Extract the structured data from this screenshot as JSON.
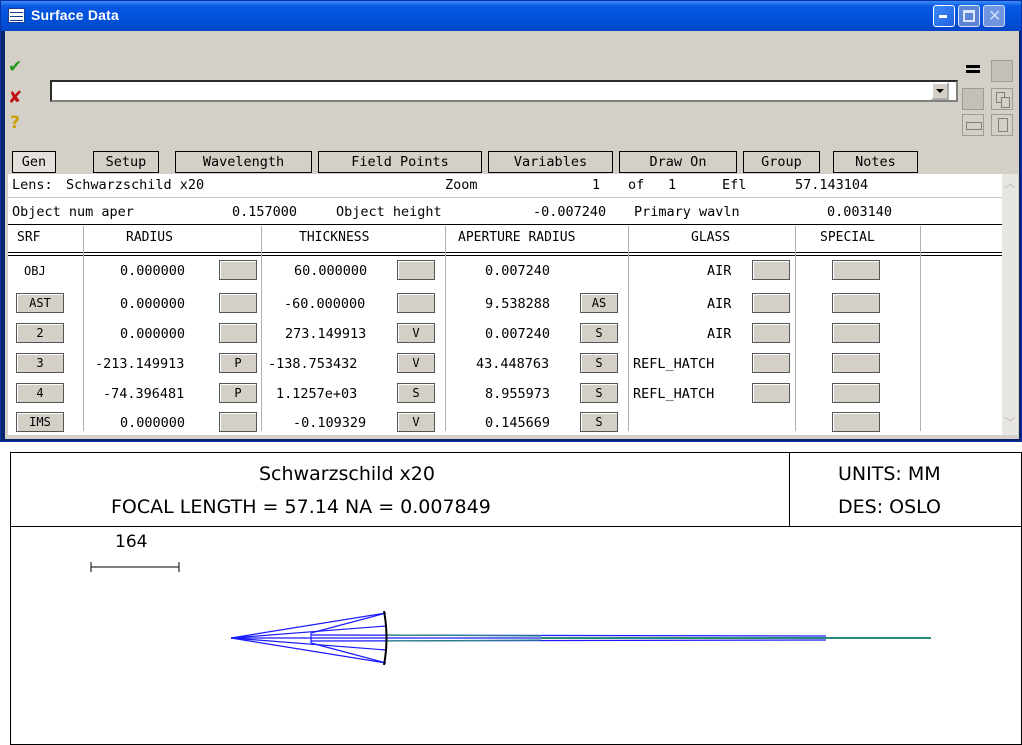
{
  "window": {
    "title": "Surface Data"
  },
  "command": {
    "accept_icon": "✔",
    "cancel_icon": "✘",
    "help_icon": "?",
    "input_value": ""
  },
  "tabs": [
    "Gen",
    "Setup",
    "Wavelength",
    "Field Points",
    "Variables",
    "Draw On",
    "Group",
    "Notes"
  ],
  "info": {
    "lens_label": "Lens:",
    "lens_name": "Schwarzschild x20",
    "zoom_label": "Zoom",
    "zoom_value": "1",
    "zoom_of": "of",
    "zoom_total": "1",
    "efl_label": "Efl",
    "efl_value": "57.143104",
    "obj_na_label": "Object num aper",
    "obj_na_value": "0.157000",
    "obj_height_label": "Object height",
    "obj_height_value": "-0.007240",
    "prim_wavln_label": "Primary wavln",
    "prim_wavln_value": "0.003140"
  },
  "columns": [
    "SRF",
    "RADIUS",
    "THICKNESS",
    "APERTURE RADIUS",
    "GLASS",
    "SPECIAL"
  ],
  "rows": [
    {
      "srf": "OBJ",
      "radius": "0.000000",
      "radius_flag": "",
      "thickness": "60.000000",
      "thickness_flag": "",
      "aperture": "0.007240",
      "aperture_flag": "",
      "glass": "AIR"
    },
    {
      "srf": "AST",
      "radius": "0.000000",
      "radius_flag": "",
      "thickness": "-60.000000",
      "thickness_flag": "",
      "aperture": "9.538288",
      "aperture_flag": "AS",
      "glass": "AIR"
    },
    {
      "srf": "2",
      "radius": "0.000000",
      "radius_flag": "",
      "thickness": "273.149913",
      "thickness_flag": "V",
      "aperture": "0.007240",
      "aperture_flag": "S",
      "glass": "AIR"
    },
    {
      "srf": "3",
      "radius": "-213.149913",
      "radius_flag": "P",
      "thickness": "-138.753432",
      "thickness_flag": "V",
      "aperture": "43.448763",
      "aperture_flag": "S",
      "glass": "REFL_HATCH"
    },
    {
      "srf": "4",
      "radius": "-74.396481",
      "radius_flag": "P",
      "thickness": "1.1257e+03",
      "thickness_flag": "S",
      "aperture": "8.955973",
      "aperture_flag": "S",
      "glass": "REFL_HATCH"
    },
    {
      "srf": "IMS",
      "radius": "0.000000",
      "radius_flag": "",
      "thickness": "-0.109329",
      "thickness_flag": "V",
      "aperture": "0.145669",
      "aperture_flag": "S",
      "glass": ""
    }
  ],
  "drawing": {
    "title_line1": "Schwarzschild x20",
    "title_line2": "FOCAL LENGTH = 57.14   NA = 0.007849",
    "units": "UNITS: MM",
    "designer": "DES: OSLO",
    "scale_value": "164",
    "colors": {
      "rays_blue": "#1a1aff",
      "rays_green": "#2a8a7a",
      "elements": "#000000"
    }
  }
}
